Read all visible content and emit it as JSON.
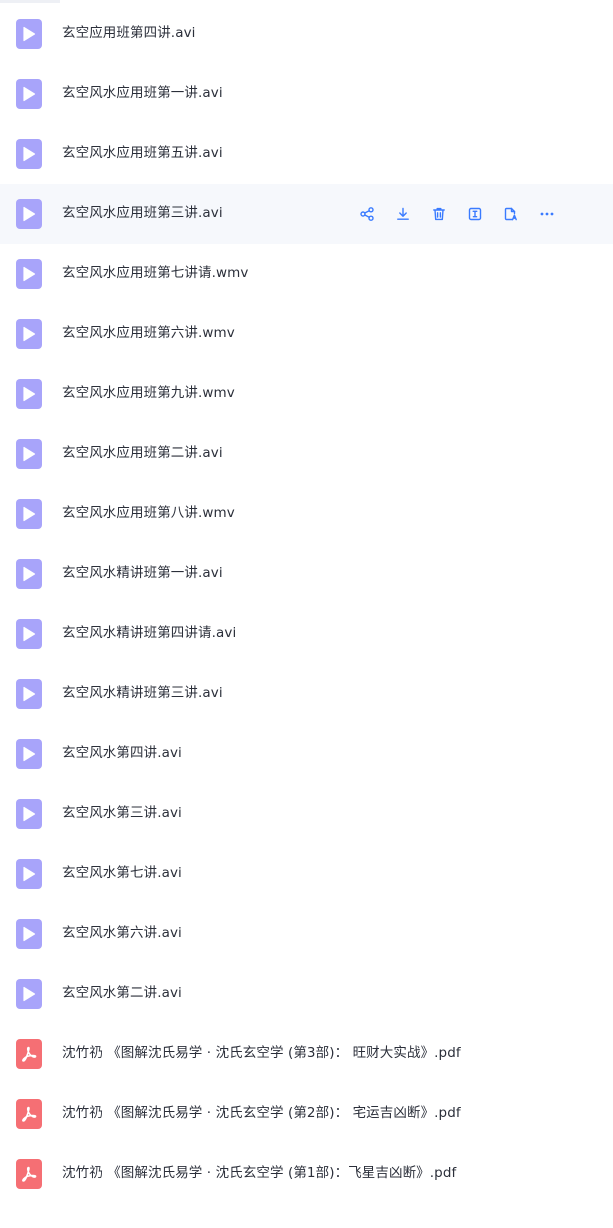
{
  "colors": {
    "video_icon": "#a8a4fa",
    "pdf_icon": "#f56f74",
    "action_icon": "#3a7bff",
    "hover_row": "#f6f8fc",
    "text": "#2b2f3a"
  },
  "row_actions": [
    {
      "name": "share-icon"
    },
    {
      "name": "download-icon"
    },
    {
      "name": "delete-icon"
    },
    {
      "name": "rename-icon"
    },
    {
      "name": "copy-link-icon"
    },
    {
      "name": "more-icon"
    }
  ],
  "files": [
    {
      "name": "玄空应用班第四讲.avi",
      "type": "video"
    },
    {
      "name": "玄空风水应用班第一讲.avi",
      "type": "video"
    },
    {
      "name": "玄空风水应用班第五讲.avi",
      "type": "video"
    },
    {
      "name": "玄空风水应用班第三讲.avi",
      "type": "video",
      "hovered": true
    },
    {
      "name": "玄空风水应用班第七讲请.wmv",
      "type": "video"
    },
    {
      "name": "玄空风水应用班第六讲.wmv",
      "type": "video"
    },
    {
      "name": "玄空风水应用班第九讲.wmv",
      "type": "video"
    },
    {
      "name": "玄空风水应用班第二讲.avi",
      "type": "video"
    },
    {
      "name": "玄空风水应用班第八讲.wmv",
      "type": "video"
    },
    {
      "name": "玄空风水精讲班第一讲.avi",
      "type": "video"
    },
    {
      "name": "玄空风水精讲班第四讲请.avi",
      "type": "video"
    },
    {
      "name": "玄空风水精讲班第三讲.avi",
      "type": "video"
    },
    {
      "name": "玄空风水第四讲.avi",
      "type": "video"
    },
    {
      "name": "玄空风水第三讲.avi",
      "type": "video"
    },
    {
      "name": "玄空风水第七讲.avi",
      "type": "video"
    },
    {
      "name": "玄空风水第六讲.avi",
      "type": "video"
    },
    {
      "name": "玄空风水第二讲.avi",
      "type": "video"
    },
    {
      "name": "沈竹礽 《图解沈氏易学 · 沈氏玄空学 (第3部)： 旺财大实战》.pdf",
      "type": "pdf"
    },
    {
      "name": "沈竹礽 《图解沈氏易学 · 沈氏玄空学 (第2部)： 宅运吉凶断》.pdf",
      "type": "pdf"
    },
    {
      "name": "沈竹礽 《图解沈氏易学 · 沈氏玄空学 (第1部)：飞星吉凶断》.pdf",
      "type": "pdf"
    }
  ]
}
